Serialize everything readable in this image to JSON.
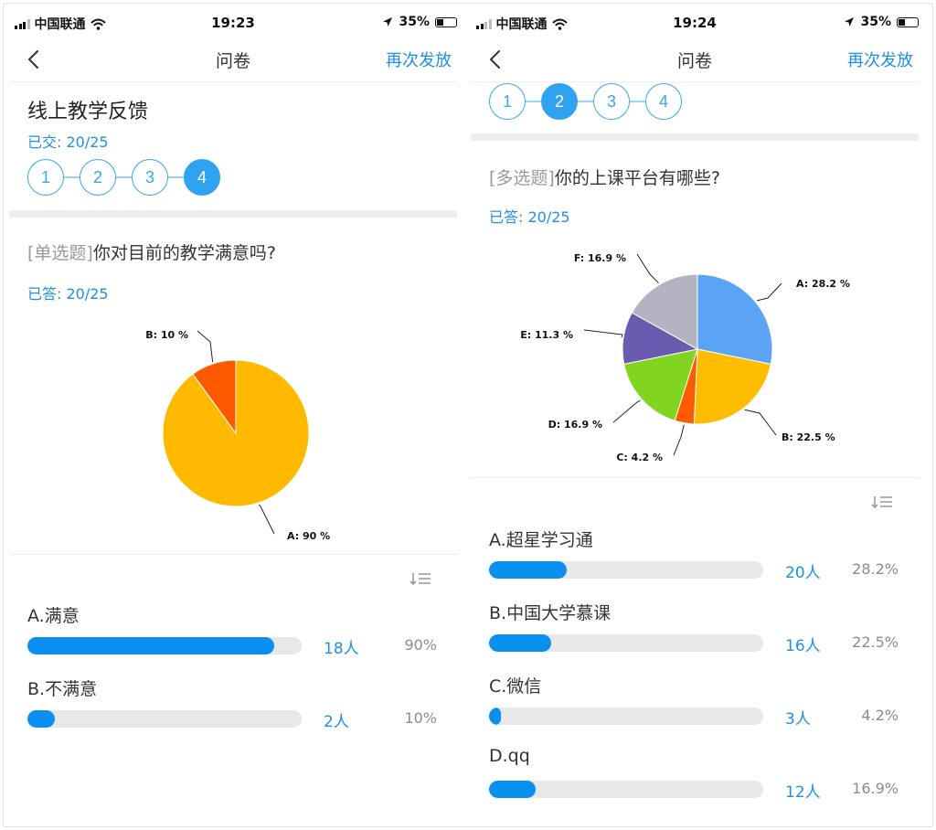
{
  "screens": [
    {
      "status": {
        "carrier": "中国联通",
        "time": "19:23",
        "battery": "35%"
      },
      "nav": {
        "title": "问卷",
        "action": "再次发放"
      },
      "survey_title": "线上教学反馈",
      "submitted": "已交: 20/25",
      "steps": [
        "1",
        "2",
        "3",
        "4"
      ],
      "active_step": 3,
      "question": {
        "type": "[单选题]",
        "text": "你对目前的教学满意吗?"
      },
      "answered": "已答: 20/25",
      "options": [
        {
          "label": "A.满意",
          "count": "18人",
          "pct": "90%",
          "fraction": 0.9
        },
        {
          "label": "B.不满意",
          "count": "2人",
          "pct": "10%",
          "fraction": 0.1
        }
      ]
    },
    {
      "status": {
        "carrier": "中国联通",
        "time": "19:24",
        "battery": "35%"
      },
      "nav": {
        "title": "问卷",
        "action": "再次发放"
      },
      "steps": [
        "1",
        "2",
        "3",
        "4"
      ],
      "active_step": 1,
      "question": {
        "type": "[多选题]",
        "text": "你的上课平台有哪些?"
      },
      "answered": "已答: 20/25",
      "options": [
        {
          "label": "A.超星学习通",
          "count": "20人",
          "pct": "28.2%",
          "fraction": 0.282
        },
        {
          "label": "B.中国大学慕课",
          "count": "16人",
          "pct": "22.5%",
          "fraction": 0.225
        },
        {
          "label": "C.微信",
          "count": "3人",
          "pct": "4.2%",
          "fraction": 0.042
        },
        {
          "label": "D.qq",
          "count": "12人",
          "pct": "16.9%",
          "fraction": 0.169
        }
      ]
    }
  ],
  "chart_data": [
    {
      "type": "pie",
      "slices": [
        {
          "label": "A: 90 %",
          "value": 90,
          "color": "#ffba00"
        },
        {
          "label": "B: 10 %",
          "value": 10,
          "color": "#ff5a00"
        }
      ]
    },
    {
      "type": "pie",
      "slices": [
        {
          "label": "A: 28.2 %",
          "value": 28.2,
          "color": "#5ba3f5"
        },
        {
          "label": "B: 22.5 %",
          "value": 22.5,
          "color": "#ffbd00"
        },
        {
          "label": "C: 4.2 %",
          "value": 4.2,
          "color": "#ff5b00"
        },
        {
          "label": "D: 16.9 %",
          "value": 16.9,
          "color": "#81d41f"
        },
        {
          "label": "E: 11.3 %",
          "value": 11.3,
          "color": "#6a5bb0"
        },
        {
          "label": "F: 16.9 %",
          "value": 16.9,
          "color": "#b3b3c2"
        }
      ]
    }
  ]
}
